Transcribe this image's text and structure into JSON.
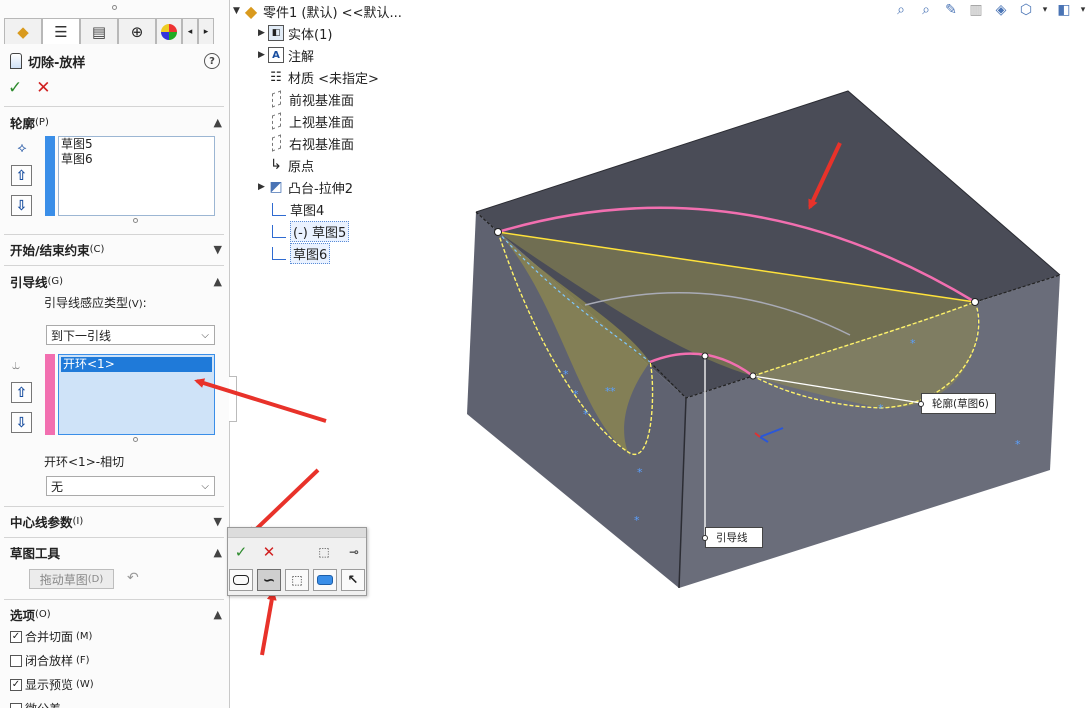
{
  "property_manager": {
    "tabs": [
      "feature-manager",
      "property-manager",
      "configuration-manager",
      "dimxpert-manager",
      "display-manager"
    ],
    "title": "切除-放样",
    "help": "?",
    "ok": "✓",
    "cancel": "✕",
    "profile": {
      "heading": "轮廓",
      "shortcut": "(P)",
      "items": [
        "草图5",
        "草图6"
      ]
    },
    "start_end": {
      "heading": "开始/结束约束",
      "shortcut": "(C)"
    },
    "guides": {
      "heading": "引导线",
      "shortcut": "(G)",
      "influence_label": "引导线感应类型",
      "influence_shortcut": "(V)",
      "influence_tail": ":",
      "influence_value": "到下一引线",
      "items": [
        "开环<1>"
      ],
      "tangency_label": "开环<1>-相切",
      "tangency_value": "无"
    },
    "centerline": {
      "heading": "中心线参数",
      "shortcut": "(I)"
    },
    "sketch_tools": {
      "heading": "草图工具",
      "drag_sketch": "拖动草图",
      "drag_shortcut": "(D)"
    },
    "options": {
      "heading": "选项",
      "shortcut": "(O)",
      "items": [
        {
          "label": "合并切面",
          "shortcut": "(M)",
          "checked": true
        },
        {
          "label": "闭合放样",
          "shortcut": "(F)",
          "checked": false
        },
        {
          "label": "显示预览",
          "shortcut": "(W)",
          "checked": true
        },
        {
          "label": "微公差",
          "shortcut": "",
          "checked": false
        }
      ]
    }
  },
  "feature_tree": {
    "root": "零件1 (默认) <<默认...",
    "items": [
      {
        "label": "实体(1)",
        "icon": "solid-bodies-icon",
        "expandable": true
      },
      {
        "label": "注解",
        "icon": "annotations-icon",
        "expandable": true
      },
      {
        "label": "材质 <未指定>",
        "icon": "material-icon",
        "expandable": false
      },
      {
        "label": "前视基准面",
        "icon": "plane-icon",
        "expandable": false
      },
      {
        "label": "上视基准面",
        "icon": "plane-icon",
        "expandable": false
      },
      {
        "label": "右视基准面",
        "icon": "plane-icon",
        "expandable": false
      },
      {
        "label": "原点",
        "icon": "origin-icon",
        "expandable": false
      },
      {
        "label": "凸台-拉伸2",
        "icon": "extrude-icon",
        "expandable": true
      },
      {
        "label": "草图4",
        "icon": "sketch-icon",
        "expandable": false
      },
      {
        "label": "(-) 草图5",
        "icon": "sketch-icon",
        "expandable": false,
        "selected": true
      },
      {
        "label": "草图6",
        "icon": "sketch-icon",
        "expandable": false,
        "selected": true
      }
    ]
  },
  "viewport": {
    "callouts": {
      "profile": "轮廓(草图6)",
      "guide": "引导线"
    }
  },
  "floating_toolbar": {
    "ok": "✓",
    "cancel": "✕"
  },
  "colors": {
    "accent_blue": "#3a8ee8",
    "guide_pink": "#f26fb0",
    "model_face": "#5c5f6b",
    "model_top": "#4a4c57",
    "arrow_red": "#e8322a",
    "preview_fill": "#8f8a4e"
  }
}
